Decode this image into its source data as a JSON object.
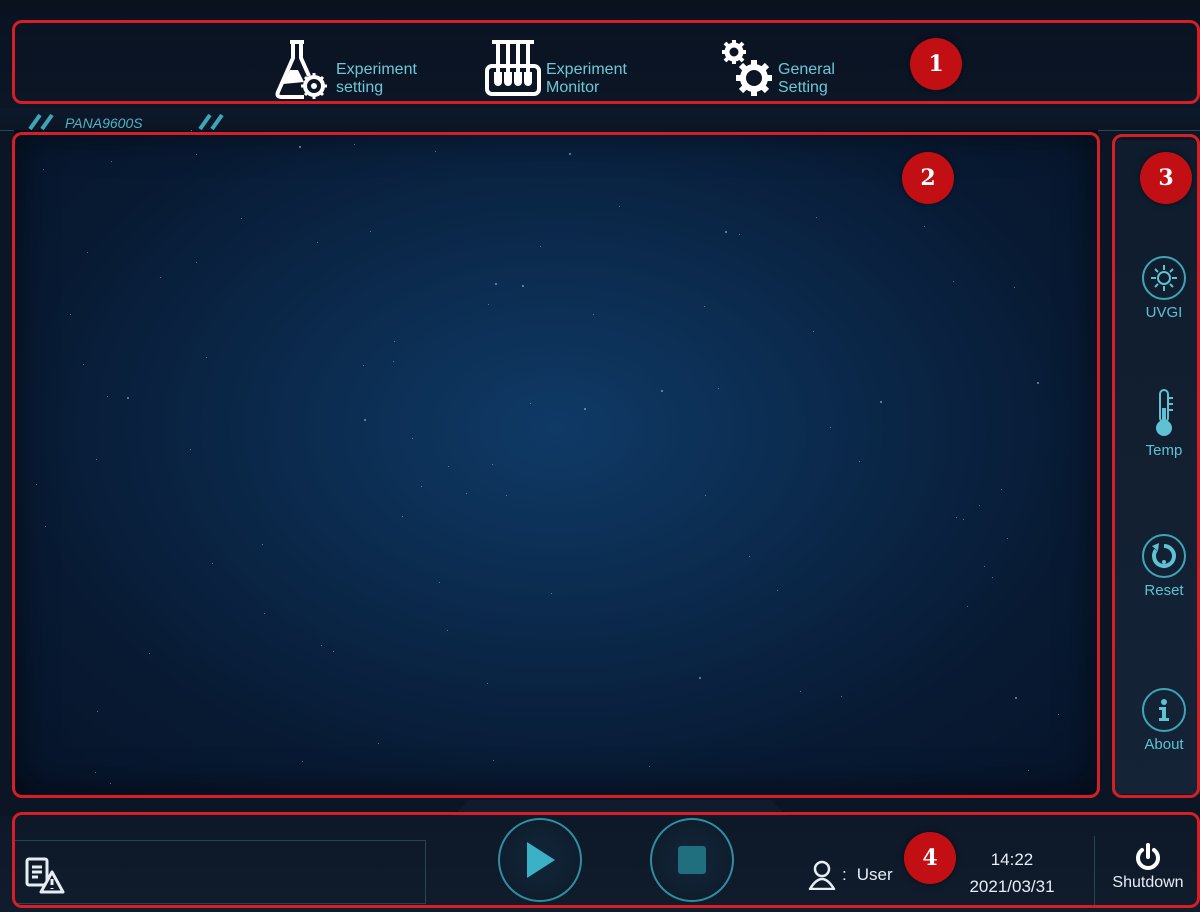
{
  "nav": [
    {
      "line1": "Experiment",
      "line2": "setting",
      "icon": "flask-gear-icon"
    },
    {
      "line1": "Experiment",
      "line2": "Monitor",
      "icon": "test-tube-rack-icon"
    },
    {
      "line1": "General",
      "line2": "Setting",
      "icon": "gears-icon"
    }
  ],
  "model": "PANA9600S",
  "side": {
    "uvgi": "UVGI",
    "temp": "Temp",
    "reset": "Reset",
    "about": "About"
  },
  "status": {
    "user_separator": ":",
    "user": "User",
    "time": "14:22",
    "date": "2021/03/31",
    "shutdown": "Shutdown"
  },
  "callouts": [
    "1",
    "2",
    "3",
    "4"
  ],
  "colors": {
    "accent": "#6cc8d6",
    "callout_red": "#c20f14",
    "panel_blue": "#0b2a4d"
  }
}
